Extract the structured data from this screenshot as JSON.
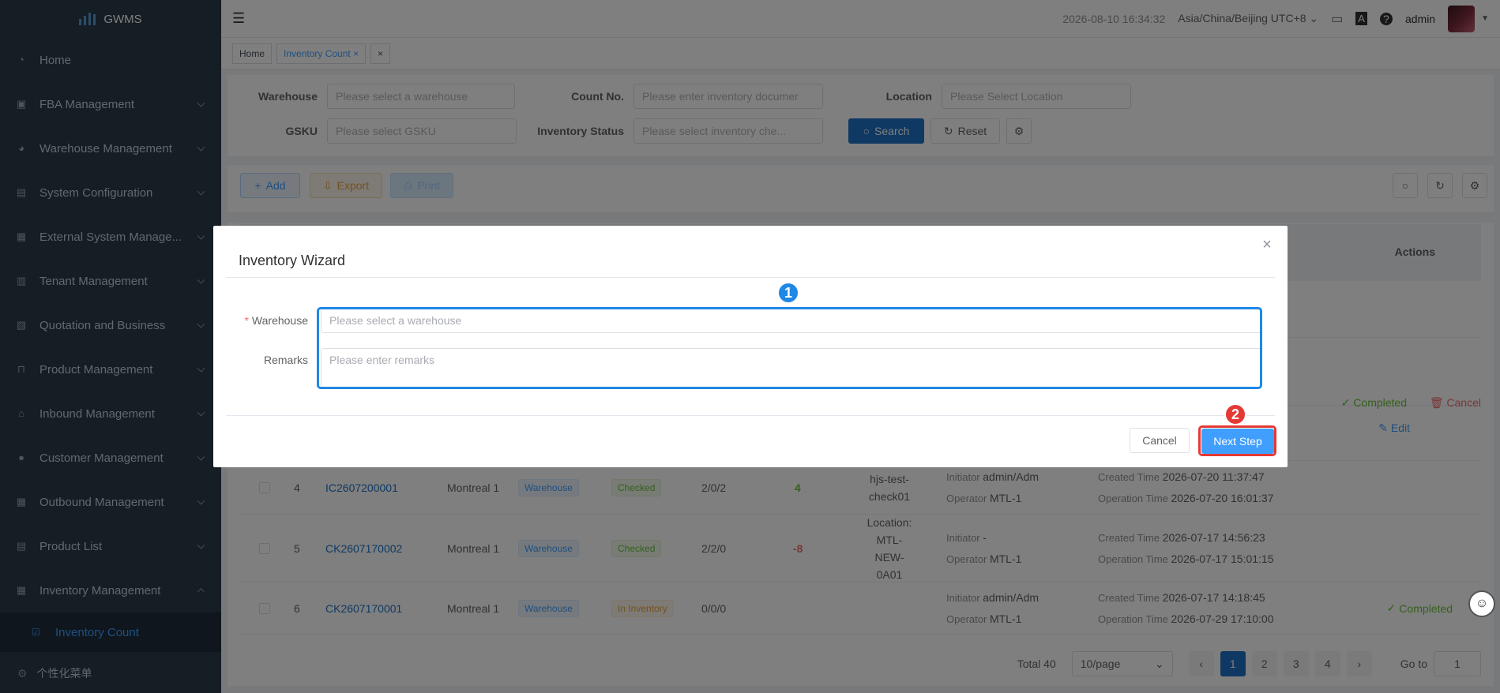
{
  "app": {
    "name": "GWMS"
  },
  "sidebar": {
    "items": [
      {
        "label": "Home",
        "icon": "dashboard-icon"
      },
      {
        "label": "FBA Management",
        "icon": "fba-icon"
      },
      {
        "label": "Warehouse Management",
        "icon": "warehouse-icon"
      },
      {
        "label": "System Configuration",
        "icon": "config-icon"
      },
      {
        "label": "External System Manage...",
        "icon": "external-icon"
      },
      {
        "label": "Tenant Management",
        "icon": "tenant-icon"
      },
      {
        "label": "Quotation and Business",
        "icon": "quotation-icon"
      },
      {
        "label": "Product Management",
        "icon": "cart-icon"
      },
      {
        "label": "Inbound Management",
        "icon": "inbound-icon"
      },
      {
        "label": "Customer Management",
        "icon": "user-icon"
      },
      {
        "label": "Outbound Management",
        "icon": "outbound-icon"
      },
      {
        "label": "Product List",
        "icon": "list-icon"
      },
      {
        "label": "Inventory Management",
        "icon": "grid-icon"
      }
    ],
    "sub_item": "Inventory Count",
    "custom_menu": "个性化菜单"
  },
  "navbar": {
    "datetime": "2026-08-10 16:34:32",
    "timezone": "Asia/China/Beijing UTC+8",
    "user": "admin"
  },
  "tabs": {
    "home": "Home",
    "current": "Inventory Count",
    "close_all": "×"
  },
  "filters": {
    "warehouse_label": "Warehouse",
    "warehouse_ph": "Please select a warehouse",
    "count_no_label": "Count No.",
    "count_no_ph": "Please enter inventory documer",
    "location_label": "Location",
    "location_ph": "Please Select Location",
    "gsku_label": "GSKU",
    "gsku_ph": "Please select GSKU",
    "status_label": "Inventory Status",
    "status_ph": "Please select inventory che...",
    "search": "Search",
    "reset": "Reset"
  },
  "toolbar": {
    "add": "Add",
    "export": "Export",
    "print": "Print"
  },
  "table": {
    "actions_header": "Actions",
    "partial_row": {
      "status": "Completed",
      "cancel": "Cancel",
      "edit": "Edit"
    },
    "rows": [
      {
        "idx": "4",
        "no": "IC2607200001",
        "wh": "Montreal 1",
        "type": "Warehouse",
        "status": "Checked",
        "qty": "2/0/2",
        "diff": "4",
        "note": "hjs-test-check01",
        "initiator": "admin/Adm",
        "operator": "MTL-1",
        "created": "2026-07-20 11:37:47",
        "optime": "2026-07-20 16:01:37",
        "action": ""
      },
      {
        "idx": "5",
        "no": "CK2607170002",
        "wh": "Montreal 1",
        "type": "Warehouse",
        "status": "Checked",
        "qty": "2/2/0",
        "diff": "-8",
        "note": "Location: MTL-NEW-0A01",
        "initiator": "-",
        "operator": "MTL-1",
        "created": "2026-07-17 14:56:23",
        "optime": "2026-07-17 15:01:15",
        "action": ""
      },
      {
        "idx": "6",
        "no": "CK2607170001",
        "wh": "Montreal 1",
        "type": "Warehouse",
        "status": "In Inventory",
        "qty": "0/0/0",
        "diff": "",
        "note": "",
        "initiator": "admin/Adm",
        "operator": "MTL-1",
        "created": "2026-07-17 14:18:45",
        "optime": "2026-07-29 17:10:00",
        "action": "Completed"
      }
    ],
    "meta_labels": {
      "initiator": "Initiator",
      "operator": "Operator",
      "created": "Created Time",
      "optime": "Operation Time"
    }
  },
  "pagination": {
    "total": "Total 40",
    "size": "10/page",
    "pages": [
      "1",
      "2",
      "3",
      "4"
    ],
    "goto": "Go to",
    "goto_value": "1"
  },
  "dialog": {
    "title": "Inventory Wizard",
    "warehouse_label": "Warehouse",
    "warehouse_ph": "Please select a warehouse",
    "remarks_label": "Remarks",
    "remarks_ph": "Please enter remarks",
    "cancel": "Cancel",
    "next": "Next Step"
  },
  "annotations": {
    "badge1": "1",
    "badge2": "2"
  },
  "colors": {
    "highlight_blue": "#1e88e5",
    "highlight_red": "#e53935",
    "primary": "#409eff",
    "sidebar": "#2b3a4a"
  }
}
